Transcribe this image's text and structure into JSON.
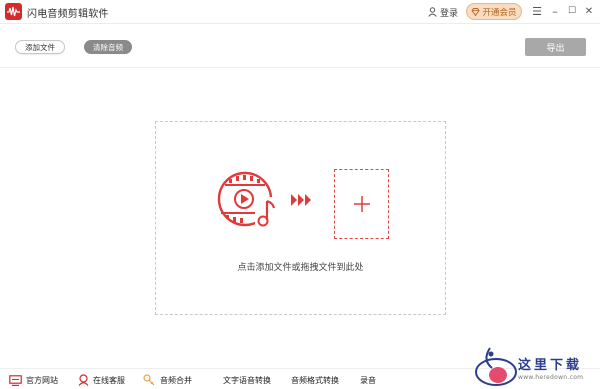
{
  "app": {
    "title": "闪电音频剪辑软件",
    "login_label": "登录",
    "member_label": "开通会员"
  },
  "window_controls": {
    "menu": "☰",
    "minimize": "–",
    "maximize": "☐",
    "close": "✕"
  },
  "toolbar": {
    "add_file_label": "添加文件",
    "clear_audio_label": "清除音频",
    "export_label": "导出"
  },
  "dropzone": {
    "hint": "点击添加文件或拖拽文件到此处",
    "plus": "+"
  },
  "bottom_bar": {
    "items": [
      {
        "label": "官方网站",
        "icon": "monitor-icon"
      },
      {
        "label": "在线客服",
        "icon": "headset-icon"
      },
      {
        "label": "音频合并",
        "icon": "merge-icon"
      },
      {
        "label": "文字语音转换",
        "icon": ""
      },
      {
        "label": "音频格式转换",
        "icon": ""
      },
      {
        "label": "录音",
        "icon": ""
      }
    ]
  },
  "watermark": {
    "title": "这里下载",
    "url": "www.heredown.com"
  },
  "colors": {
    "accent_red": "#d42b2b",
    "member_bg": "#f9dcc2",
    "export_bg": "#a8a8a8"
  }
}
